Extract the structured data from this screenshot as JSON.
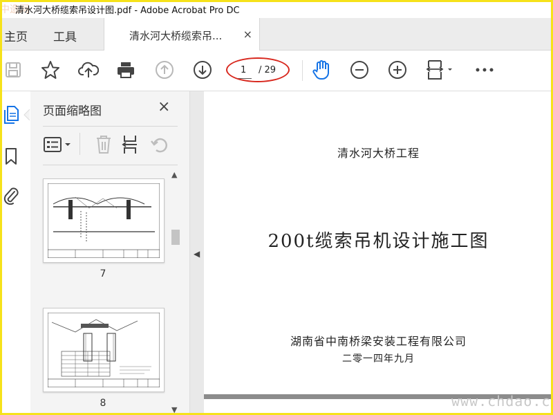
{
  "window": {
    "title": "清水河大桥缆索吊设计图.pdf - Adobe Acrobat Pro DC",
    "watermark_corner": "中造网"
  },
  "tabs": {
    "home": "主页",
    "tools": "工具",
    "document": "清水河大桥缆索吊...",
    "close": "×"
  },
  "toolbar": {
    "icons": [
      "save-icon",
      "bookmark-star-icon",
      "upload-cloud-icon",
      "print-icon",
      "previous-page-icon",
      "next-page-icon",
      "hand-tool-icon",
      "zoom-out-icon",
      "zoom-in-icon",
      "fit-page-icon",
      "more-icon"
    ],
    "current_page": "1",
    "total_pages": "/ 29",
    "highlight_color": "#d8281e",
    "accent_color": "#1473e6"
  },
  "sidebar": {
    "title": "页面缩略图",
    "close": "×",
    "icons": [
      "thumbnail-options-icon",
      "delete-page-icon",
      "insert-page-icon",
      "rotate-page-icon"
    ],
    "thumbnails": [
      {
        "label": "7"
      },
      {
        "label": "8"
      }
    ]
  },
  "rail": {
    "icons": [
      "page-thumbnails-icon",
      "bookmarks-icon",
      "attachments-icon"
    ]
  },
  "document": {
    "project": "清水河大桥工程",
    "title": "200t缆索吊机设计施工图",
    "company": "湖南省中南桥梁安装工程有限公司",
    "date": "二零一四年九月"
  },
  "watermark": "www.chdao.com"
}
